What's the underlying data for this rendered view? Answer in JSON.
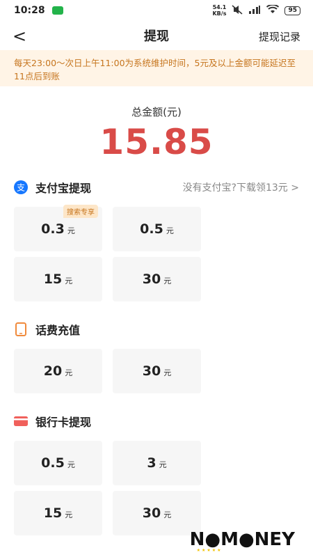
{
  "status_bar": {
    "time": "10:28",
    "speed_top": "54.1",
    "speed_bottom": "KB/s",
    "battery": "95"
  },
  "nav": {
    "back_glyph": "<",
    "title": "提现",
    "right_link": "提现记录"
  },
  "notice": "每天23:00～次日上午11:00为系统维护时间，5元及以上金额可能延迟至11点后到账",
  "total": {
    "label": "总金额(元)",
    "amount": "15.85"
  },
  "sections": {
    "alipay": {
      "title": "支付宝提现",
      "link": "没有支付宝?下载领13元 >",
      "options": [
        {
          "value": "0.3",
          "unit": "元",
          "tag": "搜索专享"
        },
        {
          "value": "0.5",
          "unit": "元"
        },
        {
          "value": "15",
          "unit": "元"
        },
        {
          "value": "30",
          "unit": "元"
        }
      ]
    },
    "phone": {
      "title": "话费充值",
      "options": [
        {
          "value": "20",
          "unit": "元"
        },
        {
          "value": "30",
          "unit": "元"
        }
      ]
    },
    "bank": {
      "title": "银行卡提现",
      "options": [
        {
          "value": "0.5",
          "unit": "元"
        },
        {
          "value": "3",
          "unit": "元"
        },
        {
          "value": "15",
          "unit": "元"
        },
        {
          "value": "30",
          "unit": "元"
        }
      ]
    }
  },
  "watermark": "N●M●NEY",
  "colors": {
    "accent_red": "#d94b48",
    "notice_bg": "#fff4e6",
    "notice_text": "#c6751e",
    "alipay_blue": "#1677ff",
    "phone_orange": "#f08a3c",
    "bank_red": "#f0605b"
  }
}
